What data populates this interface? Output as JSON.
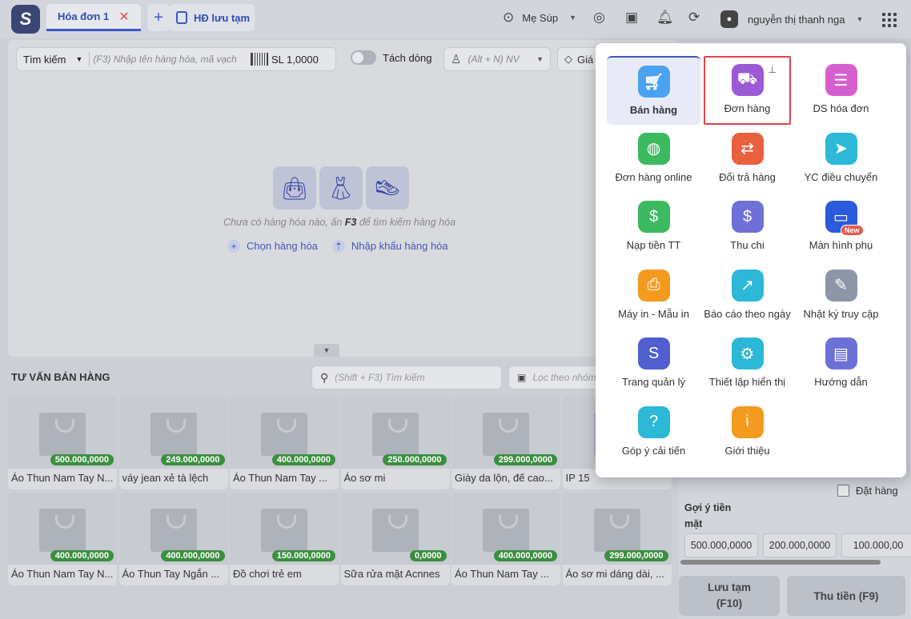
{
  "topbar": {
    "tab_active": "Hóa đơn 1",
    "tab_saved": "HĐ lưu tạm",
    "branch": "Mẹ Súp",
    "user_name": "nguyễn thị thanh nga"
  },
  "search": {
    "mode": "Tìm kiếm",
    "placeholder": "(F3) Nhập tên hàng hóa, mã vạch",
    "qty_label": "SL",
    "qty_value": "1,0000",
    "split_lines": "Tách dòng",
    "staff_placeholder": "(Alt + N) NV",
    "price_label": "Giá"
  },
  "empty": {
    "message_pre": "Chưa có hàng hóa nào, ấn ",
    "message_key": "F3",
    "message_post": " để tìm kiếm hàng hóa",
    "choose": "Chọn hàng hóa",
    "import": "Nhập khẩu hàng hóa"
  },
  "suggest": {
    "title": "TƯ VẤN BÁN HÀNG",
    "search_placeholder": "(Shift + F3) Tìm kiếm",
    "filter_placeholder": "Lọc theo nhóm"
  },
  "products": [
    {
      "name": "Áo Thun Nam Tay N...",
      "price": "500.000,0000"
    },
    {
      "name": "váy jean xẻ tà lệch",
      "price": "249.000,0000"
    },
    {
      "name": "Áo Thun Nam Tay ...",
      "price": "400.000,0000"
    },
    {
      "name": "Áo sơ mi",
      "price": "250.000,0000"
    },
    {
      "name": "Giày da lộn, đế cao...",
      "price": "299.000,0000"
    },
    {
      "name": "IP 15",
      "price": ""
    },
    {
      "name": "Áo Thun Nam Tay N...",
      "price": "400.000,0000"
    },
    {
      "name": "Áo Thun Tay Ngắn ...",
      "price": "400.000,0000"
    },
    {
      "name": "Đồ chơi trẻ em",
      "price": "150.000,0000"
    },
    {
      "name": "Sữa rửa mặt Acnnes",
      "price": "0,0000"
    },
    {
      "name": "Áo Thun Nam Tay ...",
      "price": "400.000,0000"
    },
    {
      "name": "Áo sơ mi dáng dài, ...",
      "price": "299.000,0000"
    }
  ],
  "payment": {
    "order_label": "Đặt hàng",
    "cash_title": "Gợi ý tiền mặt",
    "cash_options": [
      "500.000,0000",
      "200.000,0000",
      "100.000,00"
    ],
    "save_label": "Lưu tạm",
    "save_key": "(F10)",
    "pay_label": "Thu tiền (F9)"
  },
  "menu": {
    "items": [
      {
        "label": "Bán hàng",
        "icon": "cart-icon",
        "color": "#4aa3f0"
      },
      {
        "label": "Đơn hàng",
        "icon": "truck-icon",
        "color": "#9b59d6"
      },
      {
        "label": "DS hóa đơn",
        "icon": "document-icon",
        "color": "#d65fd0"
      },
      {
        "label": "Đơn hàng online",
        "icon": "globe-icon",
        "color": "#3cba5f"
      },
      {
        "label": "Đổi trả hàng",
        "icon": "return-icon",
        "color": "#e8603c"
      },
      {
        "label": "YC điều chuyển",
        "icon": "transfer-icon",
        "color": "#2cb8d6"
      },
      {
        "label": "Nạp tiền TT",
        "icon": "topup-icon",
        "color": "#3cba5f"
      },
      {
        "label": "Thu chi",
        "icon": "dollar-icon",
        "color": "#6f6fd8"
      },
      {
        "label": "Màn hình phụ",
        "icon": "screen-icon",
        "color": "#2b5bdc",
        "badge": "New"
      },
      {
        "label": "Máy in - Mẫu in",
        "icon": "printer-icon",
        "color": "#f39a1f"
      },
      {
        "label": "Báo cáo theo ngày",
        "icon": "report-icon",
        "color": "#2cb8d6"
      },
      {
        "label": "Nhật ký truy cập",
        "icon": "log-icon",
        "color": "#8c96a6"
      },
      {
        "label": "Trang quản lý",
        "icon": "admin-icon",
        "color": "#4f5fd0"
      },
      {
        "label": "Thiết lập hiển thị",
        "icon": "gear-icon",
        "color": "#2cb8d6"
      },
      {
        "label": "Hướng dẫn",
        "icon": "book-icon",
        "color": "#6f6fd8"
      },
      {
        "label": "Góp ý cải tiến",
        "icon": "help-icon",
        "color": "#2cb8d6"
      },
      {
        "label": "Giới thiệu",
        "icon": "info-icon",
        "color": "#f39a1f"
      }
    ]
  }
}
